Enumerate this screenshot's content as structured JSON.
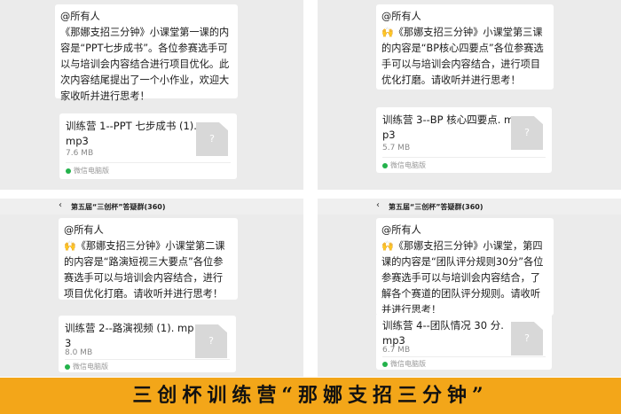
{
  "panels": [
    {
      "mention": "@所有人",
      "message": "《那娜支招三分钟》小课堂第一课的内容是“PPT七步成书”。各位参赛选手可以与培训会内容结合进行项目优化。此次内容结尾提出了一个小作业，欢迎大家收听并进行思考！",
      "file_name": "训练营 1--PPT 七步成书 (1).mp3",
      "file_size": "7.6 MB",
      "source": "微信电脑版"
    },
    {
      "mention": "@所有人",
      "message": "《那娜支招三分钟》小课堂第三课的内容是“BP核心四要点”各位参赛选手可以与培训会内容结合，进行项目优化打磨。请收听并进行思考！",
      "file_name": "训练营 3--BP 核心四要点. mp3",
      "file_size": "5.7 MB",
      "source": "微信电脑版"
    },
    {
      "chat_title": "第五届“三创杯”答疑群(360)",
      "mention": "@所有人",
      "message": "《那娜支招三分钟》小课堂第二课的内容是“路演短视三大要点”各位参赛选手可以与培训会内容结合，进行项目优化打磨。请收听并进行思考！",
      "file_name": "训练营 2--路演视频 (1). mp3",
      "file_size": "8.0 MB",
      "source": "微信电脑版"
    },
    {
      "chat_title": "第五届“三创杯”答疑群(360)",
      "mention": "@所有人",
      "message": "《那娜支招三分钟》小课堂，第四课的内容是“团队评分规则30分”各位参赛选手可以与培训会内容结合，了解各个赛道的团队评分规则。请收听并进行思考！",
      "file_name": "训练营 4--团队情况 30 分. mp3",
      "file_size": "6.7 MB",
      "source": "微信电脑版"
    }
  ],
  "icons": {
    "back": "chevron-left-icon",
    "hands": "raised-hands-icon",
    "file": "unknown-file-icon",
    "source": "wechat-dot-icon"
  },
  "banner": {
    "text": "三创杯训练营“那娜支招三分钟”"
  },
  "colors": {
    "banner_bg": "#f3a619",
    "panel_bg": "#ebebeb",
    "source_dot": "#23b24b"
  }
}
